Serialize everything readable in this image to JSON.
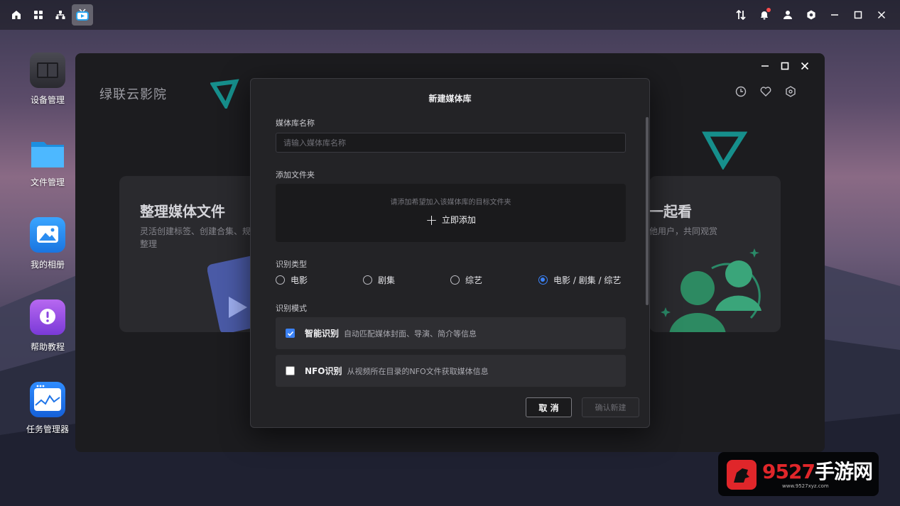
{
  "taskbar": {
    "left_icons": [
      "home-icon",
      "apps-grid-icon",
      "network-icon",
      "tv-icon"
    ],
    "right_icons": [
      "transfer-icon",
      "bell-icon",
      "user-icon",
      "settings-icon",
      "minimize-icon",
      "maximize-icon",
      "close-icon"
    ]
  },
  "desktop": {
    "items": [
      {
        "label": "设备管理",
        "icon": "device-icon"
      },
      {
        "label": "文件管理",
        "icon": "folder-icon"
      },
      {
        "label": "我的相册",
        "icon": "photo-icon"
      },
      {
        "label": "帮助教程",
        "icon": "help-icon"
      },
      {
        "label": "任务管理器",
        "icon": "task-monitor-icon"
      }
    ]
  },
  "app": {
    "title": "绿联云影院",
    "tools": [
      "history-icon",
      "favorite-icon",
      "settings-icon"
    ],
    "card_left": {
      "title": "整理媒体文件",
      "desc": "灵活创建标签、创建合集、规",
      "desc2": "整理"
    },
    "card_right": {
      "title": "一起看",
      "desc": "他用户，共同观赏"
    }
  },
  "dialog": {
    "title": "新建媒体库",
    "name_label": "媒体库名称",
    "name_placeholder": "请输入媒体库名称",
    "name_value": "",
    "folder_label": "添加文件夹",
    "folder_hint": "请添加希望加入该媒体库的目标文件夹",
    "add_button": "立即添加",
    "type_label": "识别类型",
    "types": [
      {
        "label": "电影",
        "selected": false
      },
      {
        "label": "剧集",
        "selected": false
      },
      {
        "label": "综艺",
        "selected": false
      },
      {
        "label": "电影 / 剧集 / 综艺",
        "selected": true
      }
    ],
    "mode_label": "识别模式",
    "modes": [
      {
        "name": "智能识别",
        "desc": "自动匹配媒体封面、导演、简介等信息",
        "checked": true
      },
      {
        "name": "NFO识别",
        "desc": "从视频所在目录的NFO文件获取媒体信息",
        "checked": false
      }
    ],
    "cancel_button": "取 消",
    "confirm_button": "确认新建"
  },
  "watermark": {
    "text_main": "9527",
    "text_cn": "手游网",
    "text_sub": "www.9527xyz.com"
  },
  "colors": {
    "accent": "#3b82f6",
    "teal": "#1ab3b0",
    "green": "#2a9a6e"
  }
}
